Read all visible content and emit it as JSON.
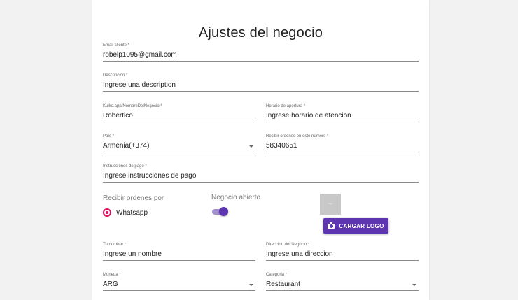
{
  "title": "Ajustes del negocio",
  "fields": {
    "email": {
      "label": "Email cliente *",
      "value": "robelp1095@gmail.com"
    },
    "description": {
      "label": "Descripcion *",
      "value": "Ingrese una description"
    },
    "business_url": {
      "label": "Kulko.app/NombreDelNegocio *",
      "value": "Robertico"
    },
    "opening_hours": {
      "label": "Horario de apertura *",
      "value": "Ingrese horario de atencion"
    },
    "country": {
      "label": "País *",
      "value": "Armenia(+374)"
    },
    "order_number": {
      "label": "Recibir ordenes en este número *",
      "value": "58340651"
    },
    "payment_instructions": {
      "label": "Instrucciones de pago *",
      "value": "Ingrese instrucciones de pago"
    },
    "name": {
      "label": "Tu nombre *",
      "value": "Ingrese un nombre"
    },
    "address": {
      "label": "Direccion del Negocio *",
      "value": "Ingrese una direccion"
    },
    "currency": {
      "label": "Moneda *",
      "value": "ARG"
    },
    "category": {
      "label": "Categoria *",
      "value": "Restaurant"
    }
  },
  "orders_via": {
    "label": "Recibir ordenes por",
    "option": "Whatsapp",
    "selected": true
  },
  "open_business": {
    "label": "Negocio abierto",
    "on": true
  },
  "logo": {
    "placeholder_text": "logo",
    "upload_label": "CARGAR LOGO"
  },
  "colors": {
    "accent": "#5e35b1",
    "radio": "#e0115f"
  }
}
